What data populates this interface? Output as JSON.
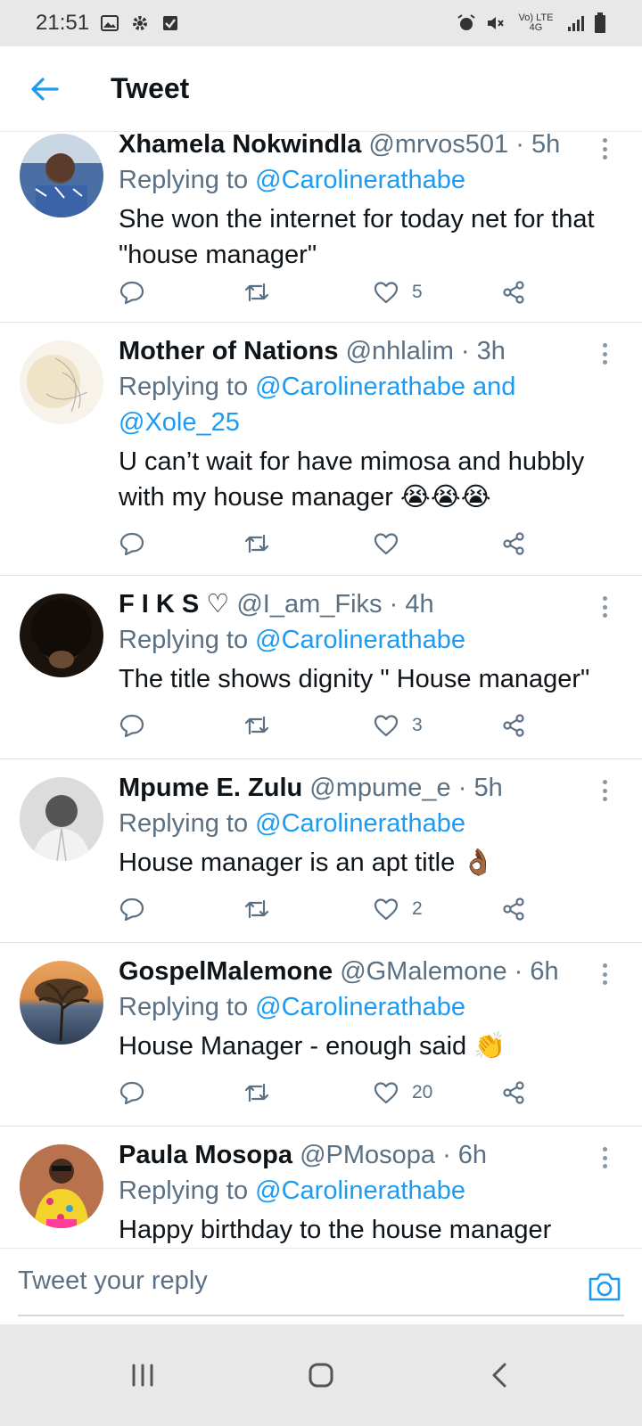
{
  "status": {
    "time": "21:51",
    "right_text": "Vo) LTE 4G"
  },
  "header": {
    "title": "Tweet"
  },
  "tweets": [
    {
      "name": "Xhamela Nokwindla",
      "meta": "@mrvos501 · 5h",
      "reply_prefix": "Replying to ",
      "reply_mentions": "@Carolinerathabe",
      "text": "She won the internet for today net for that \"house manager\"",
      "likes": "5"
    },
    {
      "name": "Mother of Nations",
      "meta": "@nhlalim · 3h",
      "reply_prefix": "Replying to ",
      "reply_mentions": "@Carolinerathabe and",
      "reply_mentions_2": "@Xole_25",
      "text": "U can’t wait for have mimosa and hubbly with my house manager 😭😭😭",
      "likes": ""
    },
    {
      "name": "F I K S ♡",
      "meta": "@I_am_Fiks · 4h",
      "reply_prefix": "Replying to ",
      "reply_mentions": "@Carolinerathabe",
      "text": "The title shows dignity \" House manager\"",
      "likes": "3"
    },
    {
      "name": "Mpume E. Zulu",
      "meta": "@mpume_e · 5h",
      "reply_prefix": "Replying to ",
      "reply_mentions": "@Carolinerathabe",
      "text": "House manager is an apt title 👌🏾",
      "likes": "2"
    },
    {
      "name": "GospelMalemone",
      "meta": "@GMalemone · 6h",
      "reply_prefix": "Replying to ",
      "reply_mentions": "@Carolinerathabe",
      "text": "House Manager - enough said 👏",
      "likes": "20"
    },
    {
      "name": "Paula Mosopa",
      "meta": "@PMosopa · 6h",
      "reply_prefix": "Replying to ",
      "reply_mentions": "@Carolinerathabe",
      "text": "Happy birthday to the house manager"
    }
  ],
  "reply_box": {
    "placeholder": "Tweet your reply"
  },
  "colors": {
    "accent": "#1d9bf0",
    "muted": "#5b7083",
    "text": "#0f1419",
    "system_bar": "#e8e8e8"
  },
  "icons": {
    "back": "arrow-left-icon",
    "reply": "comment-icon",
    "retweet": "retweet-icon",
    "like": "heart-icon",
    "share": "share-icon",
    "more": "more-vertical-icon",
    "camera": "camera-icon"
  }
}
